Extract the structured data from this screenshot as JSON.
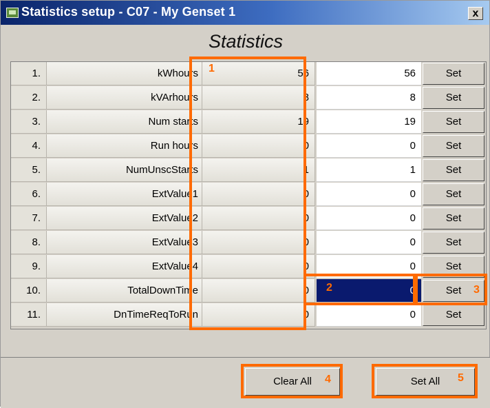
{
  "window": {
    "title": "Statistics setup - C07 - My Genset 1",
    "close_label": "x"
  },
  "heading": "Statistics",
  "rows": [
    {
      "num": "1.",
      "name": "kWhours",
      "value": "56",
      "new_value": "56",
      "set_label": "Set"
    },
    {
      "num": "2.",
      "name": "kVArhours",
      "value": "8",
      "new_value": "8",
      "set_label": "Set"
    },
    {
      "num": "3.",
      "name": "Num starts",
      "value": "19",
      "new_value": "19",
      "set_label": "Set"
    },
    {
      "num": "4.",
      "name": "Run hours",
      "value": "0",
      "new_value": "0",
      "set_label": "Set"
    },
    {
      "num": "5.",
      "name": "NumUnscStarts",
      "value": "1",
      "new_value": "1",
      "set_label": "Set"
    },
    {
      "num": "6.",
      "name": "ExtValue1",
      "value": "0",
      "new_value": "0",
      "set_label": "Set"
    },
    {
      "num": "7.",
      "name": "ExtValue2",
      "value": "0",
      "new_value": "0",
      "set_label": "Set"
    },
    {
      "num": "8.",
      "name": "ExtValue3",
      "value": "0",
      "new_value": "0",
      "set_label": "Set"
    },
    {
      "num": "9.",
      "name": "ExtValue4",
      "value": "0",
      "new_value": "0",
      "set_label": "Set"
    },
    {
      "num": "10.",
      "name": "TotalDownTime",
      "value": "0",
      "new_value": "0",
      "set_label": "Set"
    },
    {
      "num": "11.",
      "name": "DnTimeReqToRun",
      "value": "0",
      "new_value": "0",
      "set_label": "Set"
    }
  ],
  "selected_row": "10.",
  "buttons": {
    "clear_all": "Clear All",
    "set_all": "Set All"
  },
  "annotations": [
    "1",
    "2",
    "3",
    "4",
    "5"
  ],
  "colors": {
    "highlight": "#ff6a00",
    "selection": "#0a1a6e",
    "titlebar": "#0a246a"
  }
}
